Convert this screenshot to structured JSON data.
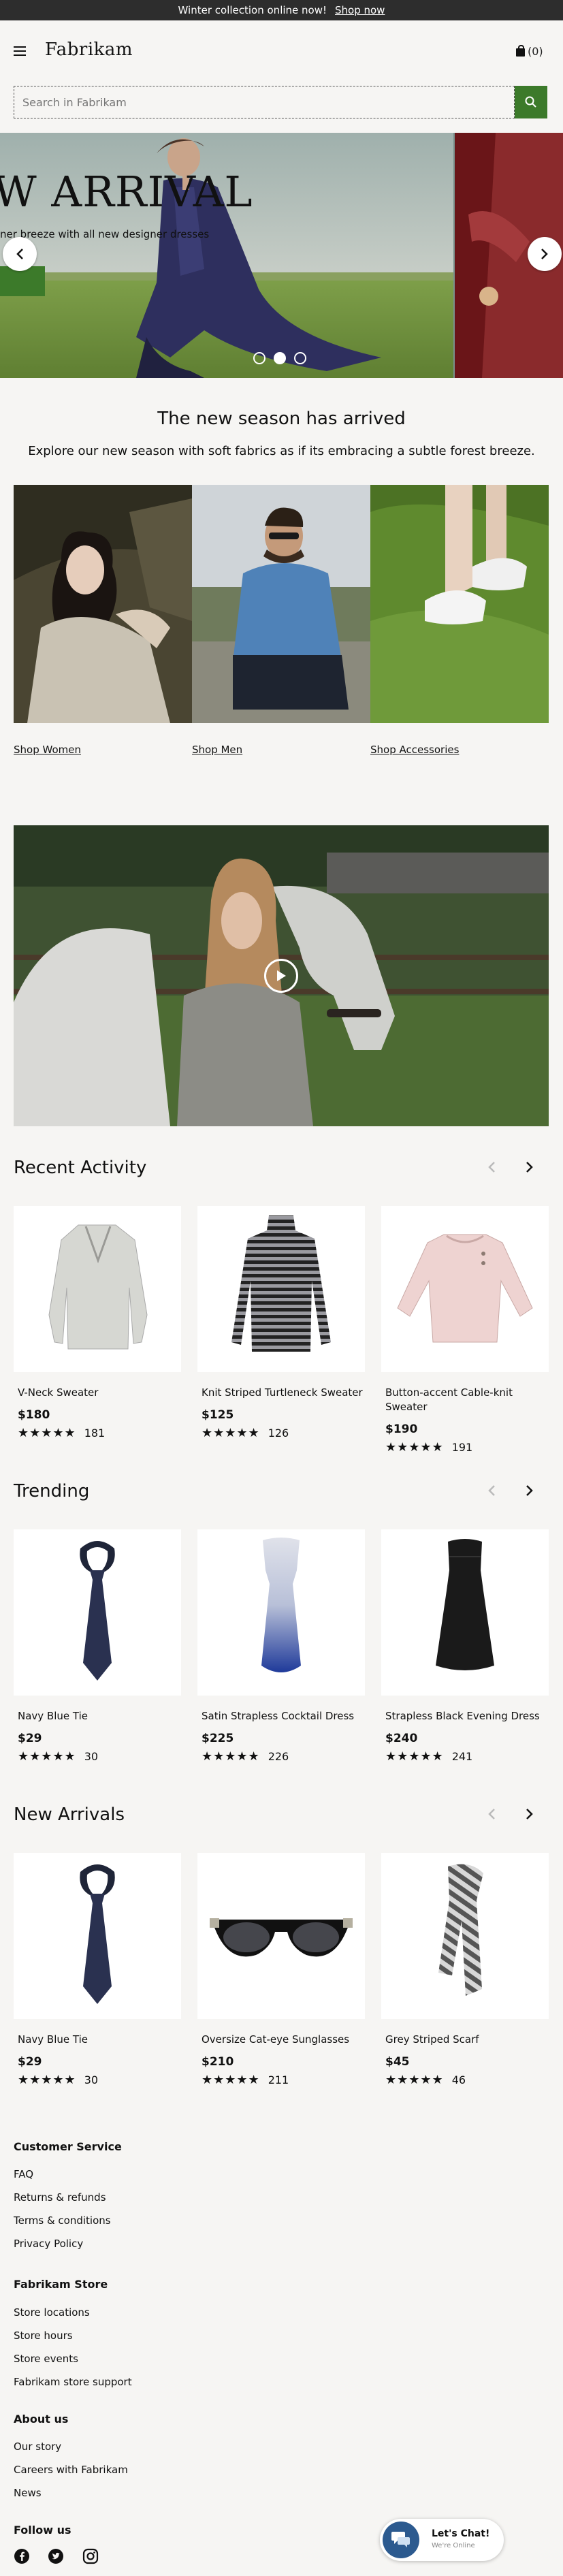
{
  "announcement": {
    "text": "Winter collection online now!",
    "link": "Shop now"
  },
  "header": {
    "logo": "Fabrikam",
    "cart_count": "(0)",
    "search_placeholder": "Search in Fabrikam"
  },
  "hero": {
    "title": "W ARRIVAL",
    "subtitle": "ner breeze with all new designer dresses",
    "slides": 3,
    "active_slide": 2
  },
  "season": {
    "title": "The new season has arrived",
    "description": "Explore our new season with soft fabrics as if its embracing a subtle forest breeze.",
    "links": [
      "Shop Women",
      "Shop Men",
      "Shop Accessories"
    ]
  },
  "sections": [
    {
      "title": "Recent Activity",
      "products": [
        {
          "name": "V-Neck Sweater",
          "price": "$180",
          "rating": 5,
          "reviews": "181",
          "icon": "sweater-light"
        },
        {
          "name": "Knit Striped Turtleneck Sweater",
          "price": "$125",
          "rating": 5,
          "reviews": "126",
          "icon": "turtleneck-striped"
        },
        {
          "name": "Button-accent Cable-knit Sweater",
          "price": "$190",
          "rating": 5,
          "reviews": "191",
          "icon": "sweater-pink"
        }
      ]
    },
    {
      "title": "Trending",
      "products": [
        {
          "name": "Navy Blue Tie",
          "price": "$29",
          "rating": 5,
          "reviews": "30",
          "icon": "tie"
        },
        {
          "name": "Satin Strapless Cocktail Dress",
          "price": "$225",
          "rating": 5,
          "reviews": "226",
          "icon": "dress-blue"
        },
        {
          "name": "Strapless Black Evening Dress",
          "price": "$240",
          "rating": 5,
          "reviews": "241",
          "icon": "dress-black"
        }
      ]
    },
    {
      "title": "New Arrivals",
      "products": [
        {
          "name": "Navy Blue Tie",
          "price": "$29",
          "rating": 5,
          "reviews": "30",
          "icon": "tie"
        },
        {
          "name": "Oversize Cat-eye Sunglasses",
          "price": "$210",
          "rating": 5,
          "reviews": "211",
          "icon": "sunglasses"
        },
        {
          "name": "Grey Striped Scarf",
          "price": "$45",
          "rating": 5,
          "reviews": "46",
          "icon": "scarf"
        }
      ]
    }
  ],
  "footer": {
    "customer_service": {
      "title": "Customer Service",
      "links": [
        "FAQ",
        "Returns & refunds",
        "Terms & conditions",
        "Privacy Policy"
      ]
    },
    "store": {
      "title": "Fabrikam Store",
      "links": [
        "Store locations",
        "Store hours",
        "Store events",
        "Fabrikam store support"
      ]
    },
    "about": {
      "title": "About us",
      "links": [
        "Our story",
        "Careers with Fabrikam",
        "News"
      ]
    },
    "follow": {
      "title": "Follow us",
      "networks": [
        "facebook-icon",
        "twitter-icon",
        "instagram-icon"
      ]
    }
  },
  "chat": {
    "title": "Let's Chat!",
    "status": "We're Online"
  },
  "colors": {
    "accent": "#3c7a2a",
    "announcement_bg": "#2d2d2d",
    "chat": "#2c5a8f"
  }
}
